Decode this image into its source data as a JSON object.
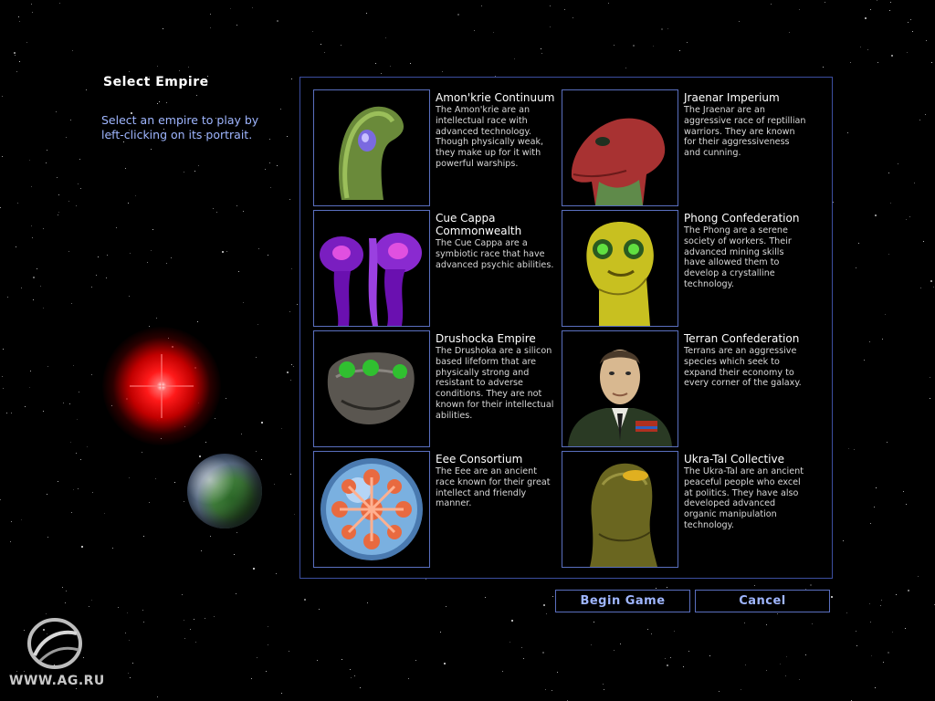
{
  "screen": {
    "title": "Select Empire",
    "instructions": "Select an empire to play by left-clicking on its portrait."
  },
  "empires": [
    {
      "name": "Amon'krie Continuum",
      "description": "The Amon'krie are an intellectual race with advanced technology. Though physically weak, they make up for it with powerful warships."
    },
    {
      "name": "Jraenar Imperium",
      "description": "The Jraenar are an aggressive race of reptillian warriors. They are known for their aggressiveness and cunning."
    },
    {
      "name": "Cue Cappa Commonwealth",
      "description": "The Cue Cappa are a symbiotic race that have advanced psychic abilities."
    },
    {
      "name": "Phong Confederation",
      "description": "The Phong are a serene society of workers. Their advanced mining skills have allowed them to develop a crystalline technology."
    },
    {
      "name": "Drushocka Empire",
      "description": "The Drushoka are a silicon based lifeform that are physically strong and resistant to adverse conditions. They are not known for their intellectual abilities."
    },
    {
      "name": "Terran Confederation",
      "description": "Terrans are an aggressive species which seek to expand their economy to every corner of the galaxy."
    },
    {
      "name": "Eee Consortium",
      "description": "The Eee are an ancient race known for their great intellect and friendly manner."
    },
    {
      "name": "Ukra-Tal Collective",
      "description": "The Ukra-Tal are an ancient peaceful people who excel at politics. They have also developed advanced organic manipulation technology."
    }
  ],
  "buttons": {
    "begin": "Begin Game",
    "cancel": "Cancel"
  },
  "watermark": "WWW.AG.RU",
  "colors": {
    "accent_text": "#9fb6ff",
    "border": "#5a6fbf",
    "background": "#000000"
  }
}
